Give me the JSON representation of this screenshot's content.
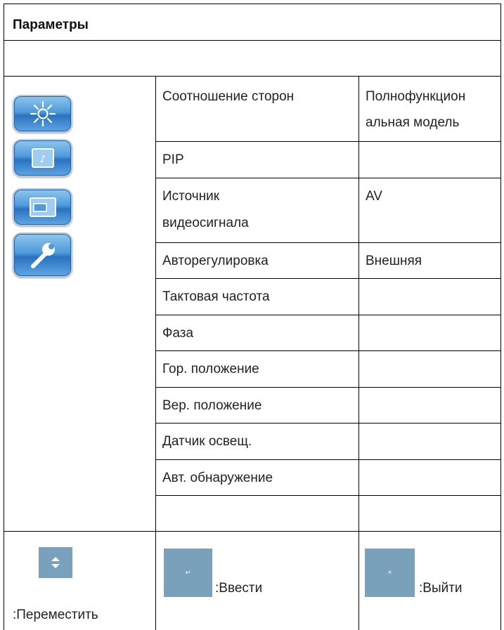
{
  "header": {
    "title": "Параметры"
  },
  "menu_icons": [
    {
      "name": "brightness-icon"
    },
    {
      "name": "audio-icon"
    },
    {
      "name": "display-icon"
    },
    {
      "name": "wrench-icon"
    }
  ],
  "settings": [
    {
      "label": "Соотношение сторон",
      "value_lines": [
        "Полнофункцион",
        "альная модель"
      ]
    },
    {
      "label": "PIP",
      "value": ""
    },
    {
      "label_lines": [
        "Источник",
        "видеосигнала"
      ],
      "value": "AV"
    },
    {
      "label": "Авторегулировка",
      "value": "Внешняя"
    },
    {
      "label": "Тактовая частота",
      "value": ""
    },
    {
      "label": "Фаза",
      "value": ""
    },
    {
      "label": "Гор. положение",
      "value": ""
    },
    {
      "label": "Вер. положение",
      "value": ""
    },
    {
      "label": "Датчик освещ.",
      "value": ""
    },
    {
      "label": "Авт. обнаружение",
      "value": ""
    },
    {
      "label": "",
      "value": ""
    }
  ],
  "legend": {
    "move": {
      "icon": "up-down-arrows-icon",
      "label": ":Переместить"
    },
    "enter": {
      "icon": "enter-icon",
      "label": ":Ввести"
    },
    "exit": {
      "icon": "close-icon",
      "label": ":Выйти"
    }
  },
  "colors": {
    "icon_blue": "#2b72c0",
    "key_button": "#7aa1bc",
    "border": "#000000"
  }
}
